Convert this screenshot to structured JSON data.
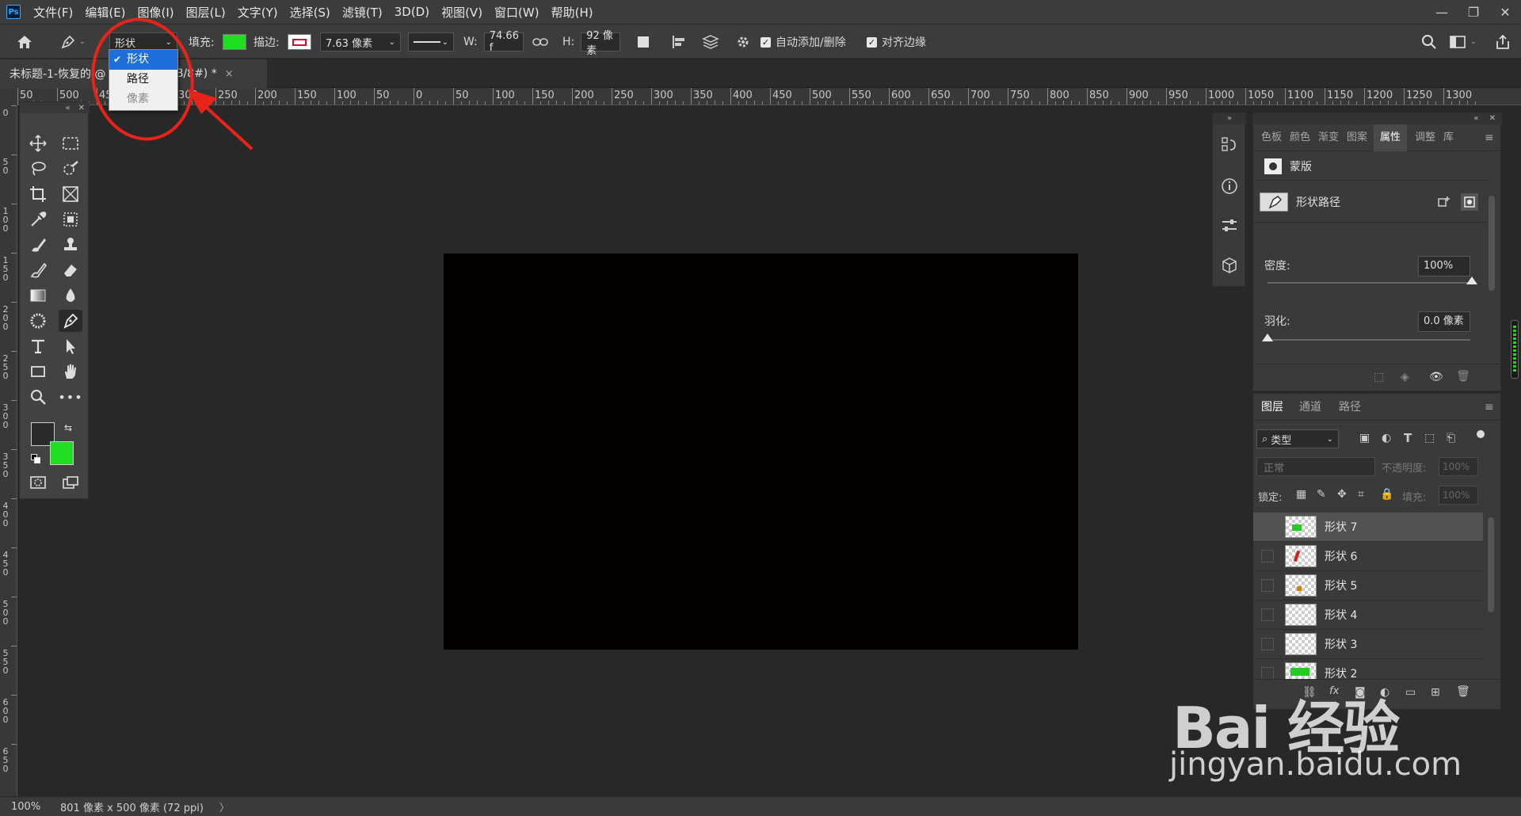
{
  "menubar": {
    "logo": "Ps",
    "items": [
      "文件(F)",
      "编辑(E)",
      "图像(I)",
      "图层(L)",
      "文字(Y)",
      "选择(S)",
      "滤镜(T)",
      "3D(D)",
      "视图(V)",
      "窗口(W)",
      "帮助(H)"
    ]
  },
  "optbar": {
    "mode_value": "形状",
    "fill_label": "填充:",
    "fill_color": "#22dd22",
    "stroke_label": "描边:",
    "stroke_color": "#cc1133",
    "stroke_width": "7.63 像素",
    "w_label": "W:",
    "w_value": "74.66 f",
    "h_label": "H:",
    "h_value": "92 像素",
    "auto_add_label": "自动添加/删除",
    "align_edges_label": "对齐边缘"
  },
  "mode_dropdown": {
    "options": [
      {
        "label": "形状",
        "state": "selected"
      },
      {
        "label": "路径",
        "state": "normal"
      },
      {
        "label": "像素",
        "state": "disabled"
      }
    ],
    "annotation_color": "#e8241a"
  },
  "doc_tab": {
    "title": "未标题-1-恢复的 @",
    "title_suffix": "7, RGB/8#) *",
    "close": "×"
  },
  "ruler_top": {
    "labels": [
      "50",
      "500",
      "450",
      "50",
      "300",
      "250",
      "200",
      "150",
      "100",
      "50",
      "0",
      "50",
      "100",
      "150",
      "200",
      "250",
      "300",
      "350",
      "400",
      "450",
      "500",
      "550",
      "600",
      "650",
      "700",
      "750",
      "800",
      "850",
      "900",
      "950",
      "1000",
      "1050",
      "1100",
      "1150",
      "1200",
      "1250",
      "1300"
    ]
  },
  "ruler_left": {
    "labels": [
      "0",
      "5 0",
      "1 0 0",
      "1 5 0",
      "2 0 0",
      "2 5 0",
      "3 0 0",
      "3 5 0",
      "4 0 0",
      "4 5 0",
      "5 0 0",
      "5 5 0",
      "6 0 0",
      "6 5 0"
    ]
  },
  "colors": {
    "foreground": "#2b2b2b",
    "background": "#22dd22",
    "canvas": "#040000"
  },
  "properties_panel": {
    "tabs": [
      "色板",
      "颜色",
      "渐变",
      "图案",
      "属性",
      "调整",
      "库"
    ],
    "active_tab": "属性",
    "mask_label": "蒙版",
    "shape_path_label": "形状路径",
    "density_label": "密度:",
    "density_value": "100%",
    "feather_label": "羽化:",
    "feather_value": "0.0 像素"
  },
  "layers_panel": {
    "tabs": [
      "图层",
      "通道",
      "路径"
    ],
    "filter_label": "类型",
    "blend_mode": "正常",
    "opacity_label": "不透明度:",
    "opacity_value": "100%",
    "lock_label": "锁定:",
    "fill_label": "填充:",
    "fill_value": "100%",
    "layers": [
      "形状 7",
      "形状 6",
      "形状 5",
      "形状 4",
      "形状 3",
      "形状 2"
    ]
  },
  "statusbar": {
    "zoom": "100%",
    "doc_info": "801 像素 x 500 像素 (72 ppi)",
    "arrow": "〉"
  },
  "watermark": {
    "line1": "Bai 经验",
    "line2": "jingyan.baidu.com"
  }
}
